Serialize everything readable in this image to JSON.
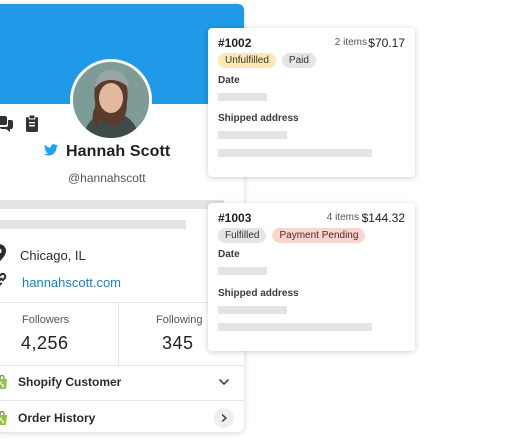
{
  "profile": {
    "name": "Hannah Scott",
    "handle": "@hannahscott",
    "location": "Chicago, IL",
    "website": "hannahscott.com",
    "followers_label": "Followers",
    "followers_value": "4,256",
    "following_label": "Following",
    "following_value": "345",
    "accordion": [
      {
        "label": "Shopify Customer",
        "icon": "shopify-bag-icon",
        "action": "chevron-down-icon"
      },
      {
        "label": "Order History",
        "icon": "shopify-bag-icon",
        "action": "chevron-right-icon"
      }
    ]
  },
  "orders": [
    {
      "id": "#1002",
      "items": "2 items",
      "total": "$70.17",
      "badges": [
        {
          "label": "Unfulfilled",
          "style": "yellow"
        },
        {
          "label": "Paid",
          "style": "gray"
        }
      ],
      "date_label": "Date",
      "shipped_label": "Shipped address"
    },
    {
      "id": "#1003",
      "items": "4 items",
      "total": "$144.32",
      "badges": [
        {
          "label": "Fulfilled",
          "style": "gray"
        },
        {
          "label": "Payment Pending",
          "style": "red"
        }
      ],
      "date_label": "Date",
      "shipped_label": "Shipped address"
    }
  ],
  "colors": {
    "cover": "#1f99e8",
    "twitter": "#1da1f2",
    "link": "#1f7fc4",
    "shopify": "#95bf47"
  }
}
